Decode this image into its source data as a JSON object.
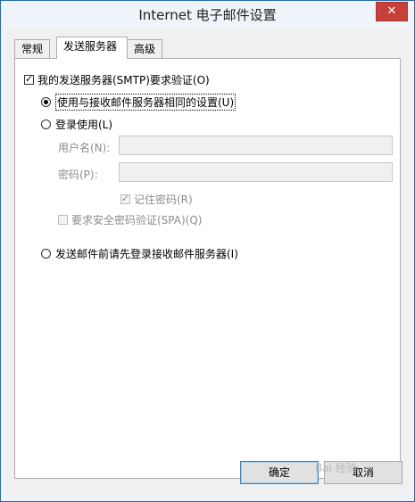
{
  "window": {
    "title": "Internet 电子邮件设置",
    "close_glyph": "✕"
  },
  "tabs": [
    {
      "label": "常规",
      "active": false
    },
    {
      "label": "发送服务器",
      "active": true
    },
    {
      "label": "高级",
      "active": false
    }
  ],
  "outgoing": {
    "auth_required": {
      "label": "我的发送服务器(SMTP)要求验证(O)",
      "checked": true
    },
    "same_as_incoming": {
      "label": "使用与接收邮件服务器相同的设置(U)",
      "checked": true
    },
    "log_on_using": {
      "label": "登录使用(L)",
      "checked": false
    },
    "username": {
      "label": "用户名(N):",
      "value": ""
    },
    "password": {
      "label": "密码(P):",
      "value": ""
    },
    "remember_password": {
      "label": "记住密码(R)",
      "checked": true,
      "enabled": false
    },
    "require_spa": {
      "label": "要求安全密码验证(SPA)(Q)",
      "checked": false,
      "enabled": false
    },
    "log_on_incoming_first": {
      "label": "发送邮件前请先登录接收邮件服务器(I)",
      "checked": false
    }
  },
  "buttons": {
    "ok": "确定",
    "cancel": "取消"
  },
  "watermark": "Bai 经验",
  "colors": {
    "titlebar": "#eef4f9",
    "close_button": "#c7403a",
    "border": "#2b6a9e"
  }
}
